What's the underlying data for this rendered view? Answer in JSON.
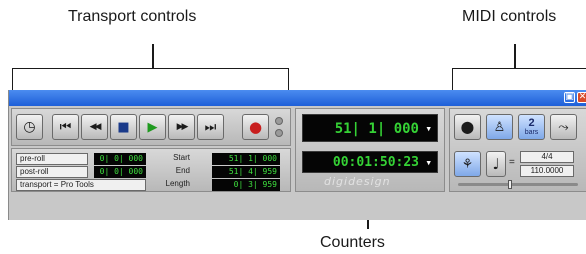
{
  "callouts": {
    "transport": "Transport controls",
    "midi": "MIDI controls",
    "counters": "Counters"
  },
  "window": {
    "zoom_glyph": "▣",
    "close_glyph": "✕"
  },
  "transport_buttons": [
    {
      "name": "online-icon",
      "glyph": "◷"
    },
    {
      "name": "return-to-zero-icon",
      "glyph": "⏮"
    },
    {
      "name": "rewind-icon",
      "glyph": "◀◀"
    },
    {
      "name": "stop-icon",
      "glyph": "■"
    },
    {
      "name": "play-icon",
      "glyph": "▶"
    },
    {
      "name": "fast-forward-icon",
      "glyph": "▶▶"
    },
    {
      "name": "go-to-end-icon",
      "glyph": "⏭"
    },
    {
      "name": "record-icon",
      "glyph": "●"
    }
  ],
  "counters": {
    "main": "51| 1| 000",
    "sub": "00:01:50:23",
    "arrow": "▾",
    "brand": "digidesign"
  },
  "preroll": {
    "label": "pre-roll",
    "value": "0| 0| 000"
  },
  "postroll": {
    "label": "post-roll",
    "value": "0| 0| 000"
  },
  "transport_mode": "transport = Pro Tools",
  "selection": {
    "start_label": "Start",
    "start_value": "51| 1| 000",
    "end_label": "End",
    "end_value": "51| 4| 959",
    "length_label": "Length",
    "length_value": "0| 3| 959"
  },
  "midi": {
    "bars_number": "2",
    "bars_unit": "bars",
    "note_glyph": "♩",
    "equals": "=",
    "meter": "4/4",
    "tempo": "110.0000"
  },
  "colors": {
    "titlebar": "#1e5fd8",
    "lcd_text": "#35d235",
    "play": "#1f9a1f",
    "record": "#c81e1e"
  }
}
